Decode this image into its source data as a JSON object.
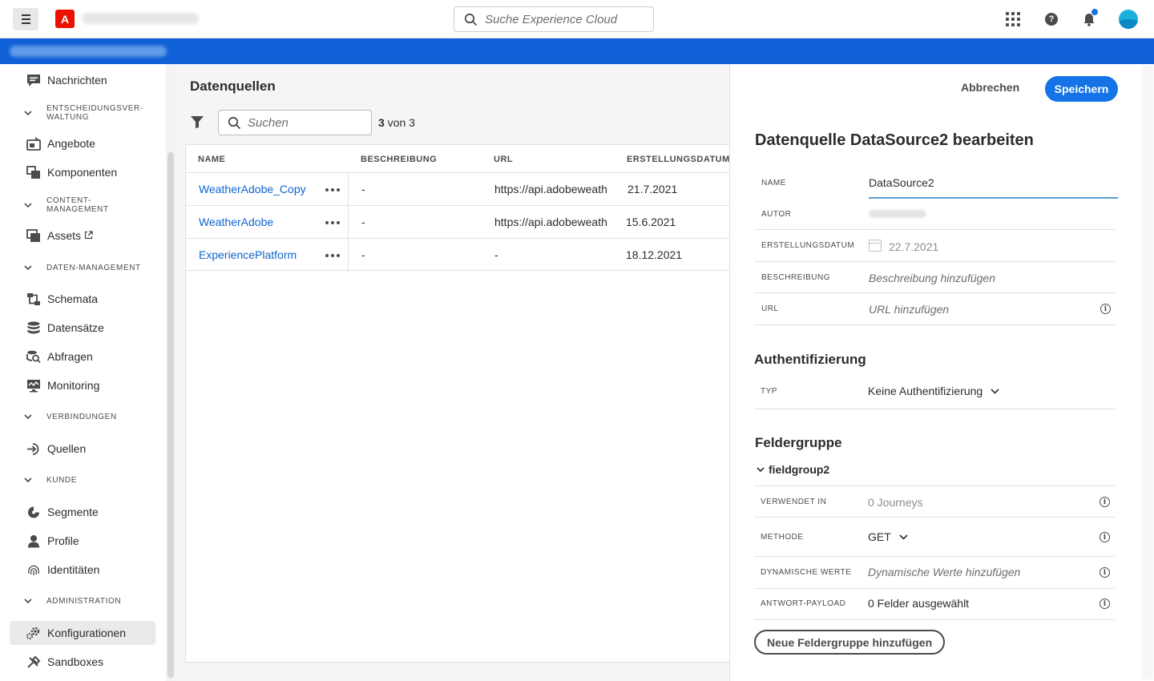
{
  "topbar": {
    "search_placeholder": "Suche Experience Cloud",
    "logo_letter": "A"
  },
  "sidebar": {
    "items": [
      {
        "type": "item",
        "label": "Nachrichten",
        "icon": "message-icon"
      },
      {
        "type": "section",
        "label": "ENTSCHEIDUNGSVER-\nWALTUNG"
      },
      {
        "type": "item",
        "label": "Angebote",
        "icon": "offer-icon"
      },
      {
        "type": "item",
        "label": "Komponenten",
        "icon": "components-icon"
      },
      {
        "type": "section",
        "label": "CONTENT-\nMANAGEMENT"
      },
      {
        "type": "item",
        "label": "Assets",
        "icon": "assets-icon"
      },
      {
        "type": "section",
        "label": "DATEN-MANAGEMENT"
      },
      {
        "type": "item",
        "label": "Schemata",
        "icon": "schema-icon"
      },
      {
        "type": "item",
        "label": "Datensätze",
        "icon": "dataset-icon"
      },
      {
        "type": "item",
        "label": "Abfragen",
        "icon": "query-icon"
      },
      {
        "type": "item",
        "label": "Monitoring",
        "icon": "monitoring-icon"
      },
      {
        "type": "section",
        "label": "VERBINDUNGEN"
      },
      {
        "type": "item",
        "label": "Quellen",
        "icon": "sources-icon"
      },
      {
        "type": "section",
        "label": "KUNDE"
      },
      {
        "type": "item",
        "label": "Segmente",
        "icon": "segments-icon"
      },
      {
        "type": "item",
        "label": "Profile",
        "icon": "profile-icon"
      },
      {
        "type": "item",
        "label": "Identitäten",
        "icon": "fingerprint-icon"
      },
      {
        "type": "section",
        "label": "ADMINISTRATION"
      },
      {
        "type": "item",
        "label": "Konfigurationen",
        "icon": "gear-icon",
        "active": true
      },
      {
        "type": "item",
        "label": "Sandboxes",
        "icon": "sandbox-icon"
      }
    ]
  },
  "main": {
    "title": "Datenquellen",
    "search_placeholder": "Suchen",
    "count_bold": "3",
    "count_rest": " von 3",
    "columns": [
      "NAME",
      "BESCHREIBUNG",
      "URL",
      "ERSTELLUNGSDATUM"
    ],
    "rows": [
      {
        "name": "WeatherAdobe_Copy",
        "description": "-",
        "url": "https://api.adobeweathe",
        "date": "21.7.2021"
      },
      {
        "name": "WeatherAdobe",
        "description": "-",
        "url": "https://api.adobeweathe",
        "date": "15.6.2021"
      },
      {
        "name": "ExperiencePlatform",
        "description": "-",
        "url": "-",
        "date": "18.12.2021"
      }
    ]
  },
  "panel": {
    "cancel_label": "Abbrechen",
    "save_label": "Speichern",
    "title": "Datenquelle DataSource2 bearbeiten",
    "fields": {
      "name_label": "NAME",
      "name_value": "DataSource2",
      "author_label": "AUTOR",
      "created_label": "ERSTELLUNGSDATUM",
      "created_value": "22.7.2021",
      "description_label": "BESCHREIBUNG",
      "description_placeholder": "Beschreibung hinzufügen",
      "url_label": "URL",
      "url_placeholder": "URL hinzufügen"
    },
    "auth": {
      "title": "Authentifizierung",
      "type_label": "TYP",
      "type_value": "Keine Authentifizierung"
    },
    "fieldgroup": {
      "title": "Feldergruppe",
      "name": "fieldgroup2",
      "used_in_label": "VERWENDET IN",
      "used_in_value": "0 Journeys",
      "method_label": "METHODE",
      "method_value": "GET",
      "dynamic_label": "DYNAMISCHE WERTE",
      "dynamic_placeholder": "Dynamische Werte hinzufügen",
      "payload_label": "ANTWORT-PAYLOAD",
      "payload_value": "0 Felder ausgewählt",
      "add_button": "Neue Feldergruppe hinzufügen"
    }
  },
  "colors": {
    "brand_blue": "#1473e6",
    "header_band": "#1060d7",
    "link": "#0d66d0",
    "adobe_red": "#eb1000"
  }
}
